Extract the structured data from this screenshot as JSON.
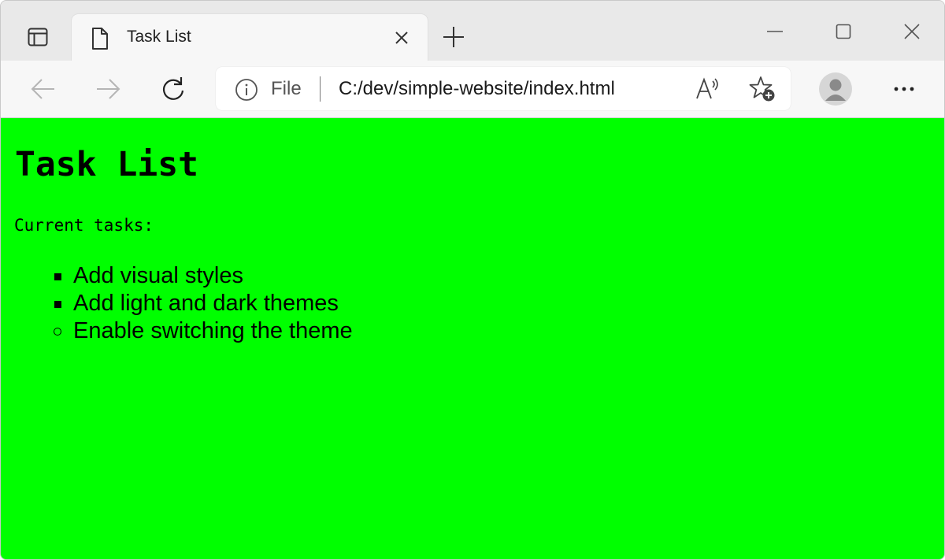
{
  "browser": {
    "tab": {
      "title": "Task List"
    },
    "address_bar": {
      "scheme_label": "File",
      "url": "C:/dev/simple-website/index.html"
    },
    "icons": {
      "tab_actions": "tab-actions-icon",
      "tab_document": "document-icon",
      "tab_close": "close-icon",
      "new_tab": "plus-icon",
      "minimize": "minimize-icon",
      "maximize": "maximize-icon",
      "window_close": "close-icon",
      "back": "arrow-left-icon",
      "forward": "arrow-right-icon",
      "refresh": "refresh-icon",
      "site_info": "info-icon",
      "read_aloud": "read-aloud-icon",
      "favorites": "star-plus-icon",
      "profile": "avatar-icon",
      "more": "ellipsis-icon"
    }
  },
  "page": {
    "background_color": "#00ff00",
    "heading": "Task List",
    "intro": "Current tasks:",
    "tasks": [
      {
        "label": "Add visual styles",
        "bullet": "square"
      },
      {
        "label": "Add light and dark themes",
        "bullet": "square"
      },
      {
        "label": "Enable switching the theme",
        "bullet": "circle"
      }
    ]
  }
}
